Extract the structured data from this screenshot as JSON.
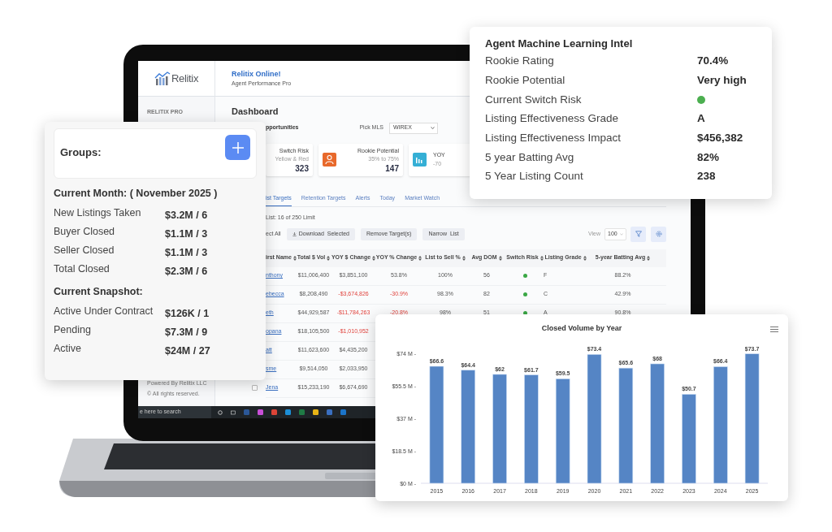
{
  "laptop": {
    "sidebar": {
      "brand": "Relitix",
      "section": "RELITIX PRO",
      "footer": [
        "Powered By Relitix LLC",
        "© All rights reserved."
      ]
    },
    "header": {
      "title": "Relitix Online!",
      "subtitle": "Agent Performance Pro"
    },
    "page_title": "Dashboard",
    "section_title": "pportunities",
    "mls": {
      "label": "Pick MLS",
      "value": "WIREX"
    },
    "stats": [
      {
        "kind": "plain",
        "label": "Switch Risk",
        "sub": "Yellow & Red",
        "value": "323"
      },
      {
        "kind": "person",
        "label": "Rookie Potential",
        "sub": "35% to 75%",
        "value": "147",
        "color": "#e8692b"
      },
      {
        "kind": "chart",
        "label": "YOY",
        "sub": "-70",
        "color": "#35afd5"
      }
    ],
    "tabs": [
      {
        "label": "ist Targets",
        "selected": true
      },
      {
        "label": "Retention Targets",
        "selected": false
      },
      {
        "label": "Alerts",
        "selected": false
      },
      {
        "label": "Today",
        "selected": false
      },
      {
        "label": "Market Watch",
        "selected": false
      }
    ],
    "list_info": "List: 16 of 250 Limit",
    "select_all": "ect All",
    "actions": [
      {
        "label": "Download  Selected",
        "kind": "download"
      },
      {
        "label": "Remove Target(s)",
        "kind": "plain"
      },
      {
        "label": "Narrow  List",
        "kind": "plain"
      }
    ],
    "view": {
      "label": "View",
      "value": "100"
    },
    "table": {
      "columns": [
        "irst Name",
        "Total $ Vol",
        "YOY $ Change",
        "YOY % Change",
        "List to Sell %",
        "Avg DOM",
        "Switch Risk",
        "Listing Grade",
        "5-year Batting Avg"
      ],
      "rows": [
        {
          "cells": [
            {
              "kind": "link",
              "text": "nthony"
            },
            {
              "kind": "text",
              "text": "$11,006,400"
            },
            {
              "kind": "text",
              "text": "$3,851,100"
            },
            {
              "kind": "text",
              "text": "53.8%"
            },
            {
              "kind": "text",
              "text": "100%"
            },
            {
              "kind": "text",
              "text": "56"
            },
            {
              "kind": "dot",
              "color": "#3aa845"
            },
            {
              "kind": "grade",
              "text": "F"
            },
            {
              "kind": "text",
              "text": "88.2%"
            }
          ]
        },
        {
          "cells": [
            {
              "kind": "link",
              "text": "ebecca"
            },
            {
              "kind": "text",
              "text": "$8,208,490"
            },
            {
              "kind": "negative",
              "text": "-$3,674,826"
            },
            {
              "kind": "negative",
              "text": "-30.9%"
            },
            {
              "kind": "text",
              "text": "98.3%"
            },
            {
              "kind": "text",
              "text": "82"
            },
            {
              "kind": "dot",
              "color": "#3aa845"
            },
            {
              "kind": "grade",
              "text": "C"
            },
            {
              "kind": "text",
              "text": "42.9%"
            }
          ]
        },
        {
          "cells": [
            {
              "kind": "link",
              "text": "eth"
            },
            {
              "kind": "text",
              "text": "$44,929,587"
            },
            {
              "kind": "negative",
              "text": "-$11,784,263"
            },
            {
              "kind": "negative",
              "text": "-20.8%"
            },
            {
              "kind": "text",
              "text": "98%"
            },
            {
              "kind": "text",
              "text": "51"
            },
            {
              "kind": "dot",
              "color": "#3aa845"
            },
            {
              "kind": "grade",
              "text": "A"
            },
            {
              "kind": "text",
              "text": "90.8%"
            }
          ]
        },
        {
          "cells": [
            {
              "kind": "link",
              "text": "opana"
            },
            {
              "kind": "text",
              "text": "$18,105,500"
            },
            {
              "kind": "negative",
              "text": "-$1,010,952"
            }
          ]
        },
        {
          "cells": [
            {
              "kind": "link",
              "text": "att"
            },
            {
              "kind": "text",
              "text": "$11,623,600"
            },
            {
              "kind": "text",
              "text": "$4,435,200"
            }
          ]
        },
        {
          "cells": [
            {
              "kind": "link",
              "text": "sme"
            },
            {
              "kind": "text",
              "text": "$9,514,050"
            },
            {
              "kind": "text",
              "text": "$2,033,950"
            }
          ]
        },
        {
          "checked": false,
          "cells": [
            {
              "kind": "link",
              "text": "Jena"
            },
            {
              "kind": "text",
              "text": "$15,233,190"
            },
            {
              "kind": "text",
              "text": "$6,674,690"
            }
          ]
        }
      ]
    },
    "taskbar": {
      "search": "e here to search"
    }
  },
  "ml_card": {
    "title": "Agent Machine Learning Intel",
    "rows": [
      {
        "label": "Rookie Rating",
        "kind": "text",
        "value": "70.4%"
      },
      {
        "label": "Rookie Potential",
        "kind": "text",
        "value": "Very high"
      },
      {
        "label": "Current Switch Risk",
        "kind": "dot",
        "color": "#4caf50"
      },
      {
        "label": "Listing Effectiveness Grade",
        "kind": "text",
        "value": "A"
      },
      {
        "label": "Listing Effectiveness Impact",
        "kind": "text",
        "value": "$456,382"
      },
      {
        "label": "5 year Batting Avg",
        "kind": "text",
        "value": "82%"
      },
      {
        "label": "5 Year Listing Count",
        "kind": "text",
        "value": "238"
      }
    ]
  },
  "groups_card": {
    "title": "Groups:",
    "month": {
      "title": "Current Month: ( November 2025 )",
      "rows": [
        {
          "label": "New Listings Taken",
          "value": "$3.2M / 6"
        },
        {
          "label": "Buyer Closed",
          "value": "$1.1M / 3"
        },
        {
          "label": "Seller Closed",
          "value": "$1.1M / 3"
        },
        {
          "label": "Total Closed",
          "value": "$2.3M / 6"
        }
      ]
    },
    "snapshot": {
      "title": "Current Snapshot:",
      "rows": [
        {
          "label": "Active Under Contract",
          "value": "$126K / 1"
        },
        {
          "label": "Pending",
          "value": "$7.3M / 9"
        },
        {
          "label": "Active",
          "value": "$24M / 27"
        }
      ]
    }
  },
  "chart_card": {
    "chart_data": {
      "type": "bar",
      "title": "Closed Volume by Year",
      "categories": [
        "2015",
        "2016",
        "2017",
        "2018",
        "2019",
        "2020",
        "2021",
        "2022",
        "2023",
        "2024",
        "2025"
      ],
      "series": [
        {
          "color": "#5585c5",
          "values": [
            66.6,
            64.4,
            62,
            61.7,
            59.5,
            73.4,
            65.6,
            68,
            50.7,
            66.4,
            73.7
          ]
        }
      ],
      "value_labels": [
        "$66.6",
        "$64.4",
        "$62",
        "$61.7",
        "$59.5",
        "$73.4",
        "$65.6",
        "$68",
        "$50.7",
        "$66.4",
        "$73.7"
      ],
      "ylim": [
        0,
        74
      ],
      "yticks": [
        {
          "value": 0,
          "label": "$0 M -"
        },
        {
          "value": 18.5,
          "label": "$18.5 M -"
        },
        {
          "value": 37,
          "label": "$37 M -"
        },
        {
          "value": 55.5,
          "label": "$55.5 M -"
        },
        {
          "value": 74,
          "label": "$74 M -"
        }
      ]
    }
  }
}
